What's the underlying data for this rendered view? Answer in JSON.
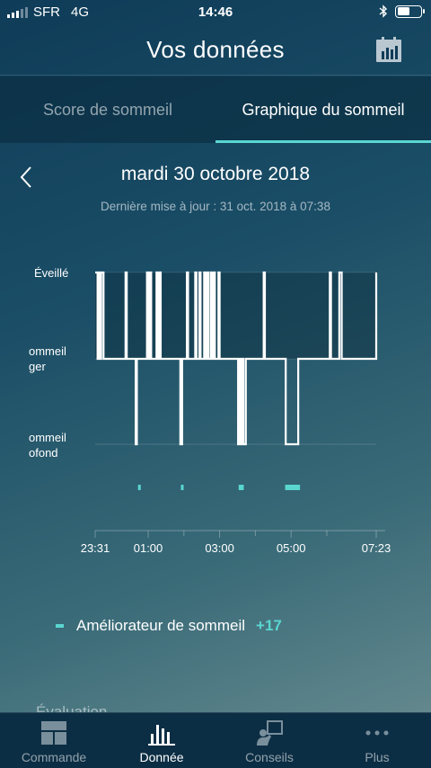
{
  "status_bar": {
    "carrier": "SFR",
    "network": "4G",
    "time": "14:46",
    "battery_level": 0.55,
    "bluetooth_icon": "bluetooth-icon"
  },
  "header": {
    "title": "Vos données",
    "calendar_icon": "calendar-chart-icon"
  },
  "tabs": [
    {
      "label": "Score de sommeil",
      "active": false
    },
    {
      "label": "Graphique du sommeil",
      "active": true
    }
  ],
  "date_nav": {
    "date": "mardi 30 octobre 2018",
    "updated": "Dernière mise à jour : 31 oct. 2018 à 07:38"
  },
  "chart_data": {
    "type": "step",
    "y_categories": [
      "Éveillé",
      "ommeil\nger",
      "ommeil\nofond"
    ],
    "x_ticks": [
      "23:31",
      "01:00",
      "03:00",
      "05:00",
      "07:23"
    ],
    "x_range": [
      "23:31",
      "07:23"
    ],
    "accent": "#5ad6d0",
    "stages": [
      [
        "23:31",
        0
      ],
      [
        "23:35",
        1
      ],
      [
        "23:37",
        0
      ],
      [
        "23:39",
        1
      ],
      [
        "23:41",
        0
      ],
      [
        "23:45",
        1
      ],
      [
        "00:22",
        0
      ],
      [
        "00:24",
        1
      ],
      [
        "00:39",
        2
      ],
      [
        "00:41",
        1
      ],
      [
        "00:58",
        0
      ],
      [
        "01:00",
        1
      ],
      [
        "01:03",
        0
      ],
      [
        "01:05",
        1
      ],
      [
        "01:14",
        0
      ],
      [
        "01:16",
        1
      ],
      [
        "01:19",
        0
      ],
      [
        "01:21",
        1
      ],
      [
        "01:54",
        2
      ],
      [
        "01:57",
        1
      ],
      [
        "02:05",
        0
      ],
      [
        "02:07",
        1
      ],
      [
        "02:19",
        0
      ],
      [
        "02:21",
        1
      ],
      [
        "02:26",
        0
      ],
      [
        "02:28",
        1
      ],
      [
        "02:34",
        0
      ],
      [
        "02:36",
        1
      ],
      [
        "02:39",
        0
      ],
      [
        "02:41",
        1
      ],
      [
        "02:45",
        0
      ],
      [
        "02:47",
        1
      ],
      [
        "02:50",
        0
      ],
      [
        "02:52",
        1
      ],
      [
        "02:58",
        0
      ],
      [
        "03:00",
        1
      ],
      [
        "03:31",
        2
      ],
      [
        "03:34",
        1
      ],
      [
        "03:36",
        2
      ],
      [
        "03:38",
        1
      ],
      [
        "03:40",
        2
      ],
      [
        "03:44",
        1
      ],
      [
        "04:14",
        0
      ],
      [
        "04:16",
        1
      ],
      [
        "04:51",
        2
      ],
      [
        "05:12",
        1
      ],
      [
        "06:05",
        0
      ],
      [
        "06:07",
        1
      ],
      [
        "06:21",
        0
      ],
      [
        "06:25",
        1
      ],
      [
        "07:23",
        0
      ]
    ],
    "sleep_enhancer_events": [
      [
        "00:43",
        "00:45"
      ],
      [
        "01:55",
        "01:57"
      ],
      [
        "03:32",
        "03:34"
      ],
      [
        "03:36",
        "03:38"
      ],
      [
        "04:50",
        "05:15"
      ]
    ]
  },
  "legend": {
    "label": "Améliorateur de sommeil",
    "value": "+17"
  },
  "partial_text": "Évaluation",
  "bottom_nav": [
    {
      "label": "Commande",
      "icon": "dashboard-icon",
      "active": false
    },
    {
      "label": "Donnée",
      "icon": "bar-chart-icon",
      "active": true
    },
    {
      "label": "Conseils",
      "icon": "advice-icon",
      "active": false
    },
    {
      "label": "Plus",
      "icon": "more-icon",
      "active": false
    }
  ]
}
